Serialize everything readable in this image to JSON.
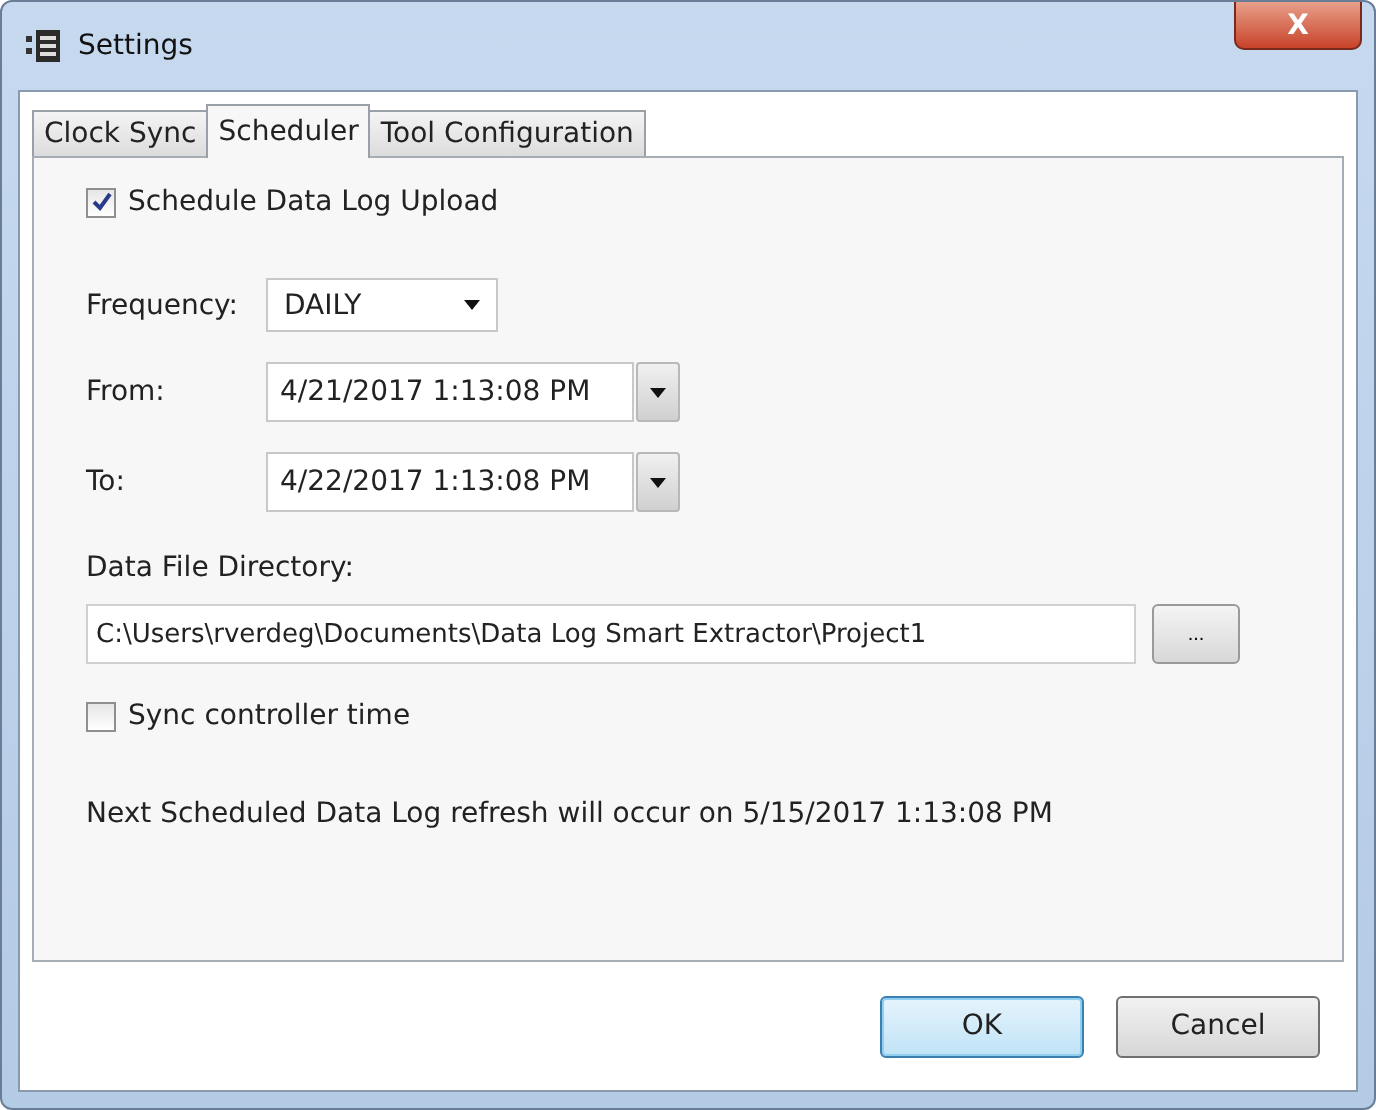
{
  "window": {
    "title": "Settings",
    "close": "X"
  },
  "tabs": [
    {
      "label": "Clock Sync",
      "selected": false
    },
    {
      "label": "Scheduler",
      "selected": true
    },
    {
      "label": "Tool Configuration",
      "selected": false
    }
  ],
  "schedule_upload": {
    "label": "Schedule Data Log Upload",
    "checked": true
  },
  "frequency": {
    "label": "Frequency:",
    "value": "DAILY"
  },
  "from": {
    "label": "From:",
    "value": "4/21/2017 1:13:08 PM"
  },
  "to": {
    "label": "To:",
    "value": "4/22/2017 1:13:08 PM"
  },
  "directory": {
    "label": "Data File Directory:",
    "value": "C:\\Users\\rverdeg\\Documents\\Data Log Smart Extractor\\Project1",
    "browse": "..."
  },
  "sync_time": {
    "label": "Sync controller time",
    "checked": false
  },
  "next_refresh": "Next Scheduled Data Log refresh will occur on 5/15/2017 1:13:08 PM",
  "buttons": [
    {
      "label": "OK",
      "default": true
    },
    {
      "label": "Cancel",
      "default": false
    }
  ]
}
